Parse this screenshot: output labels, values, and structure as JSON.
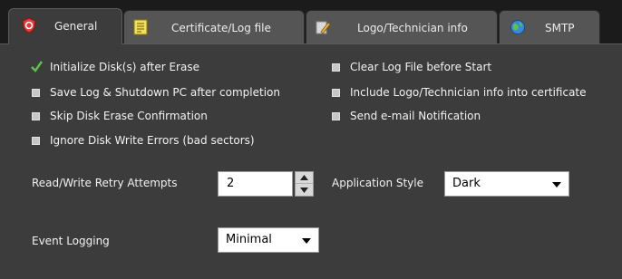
{
  "tabs": [
    {
      "label": "General",
      "icon": "shield-icon",
      "active": true
    },
    {
      "label": "Certificate/Log file",
      "icon": "document-icon",
      "active": false
    },
    {
      "label": "Logo/Technician info",
      "icon": "pencil-icon",
      "active": false
    },
    {
      "label": "SMTP",
      "icon": "globe-icon",
      "active": false
    }
  ],
  "options_left": [
    {
      "label": "Initialize Disk(s) after Erase",
      "checked": true
    },
    {
      "label": "Save Log & Shutdown PC after completion",
      "checked": false
    },
    {
      "label": "Skip Disk Erase Confirmation",
      "checked": false
    },
    {
      "label": "Ignore Disk Write Errors (bad sectors)",
      "checked": false
    }
  ],
  "options_right": [
    {
      "label": "Clear Log File before Start",
      "checked": false
    },
    {
      "label": "Include Logo/Technician info into certificate",
      "checked": false
    },
    {
      "label": "Send e-mail Notification",
      "checked": false
    }
  ],
  "retry": {
    "label": "Read/Write Retry Attempts",
    "value": "2"
  },
  "style": {
    "label": "Application Style",
    "value": "Dark"
  },
  "logging": {
    "label": "Event Logging",
    "value": "Minimal"
  },
  "colors": {
    "background": "#3c3c3c",
    "tabbar": "#1b1b1b",
    "tab": "#555555",
    "check": "#5cc24a"
  }
}
